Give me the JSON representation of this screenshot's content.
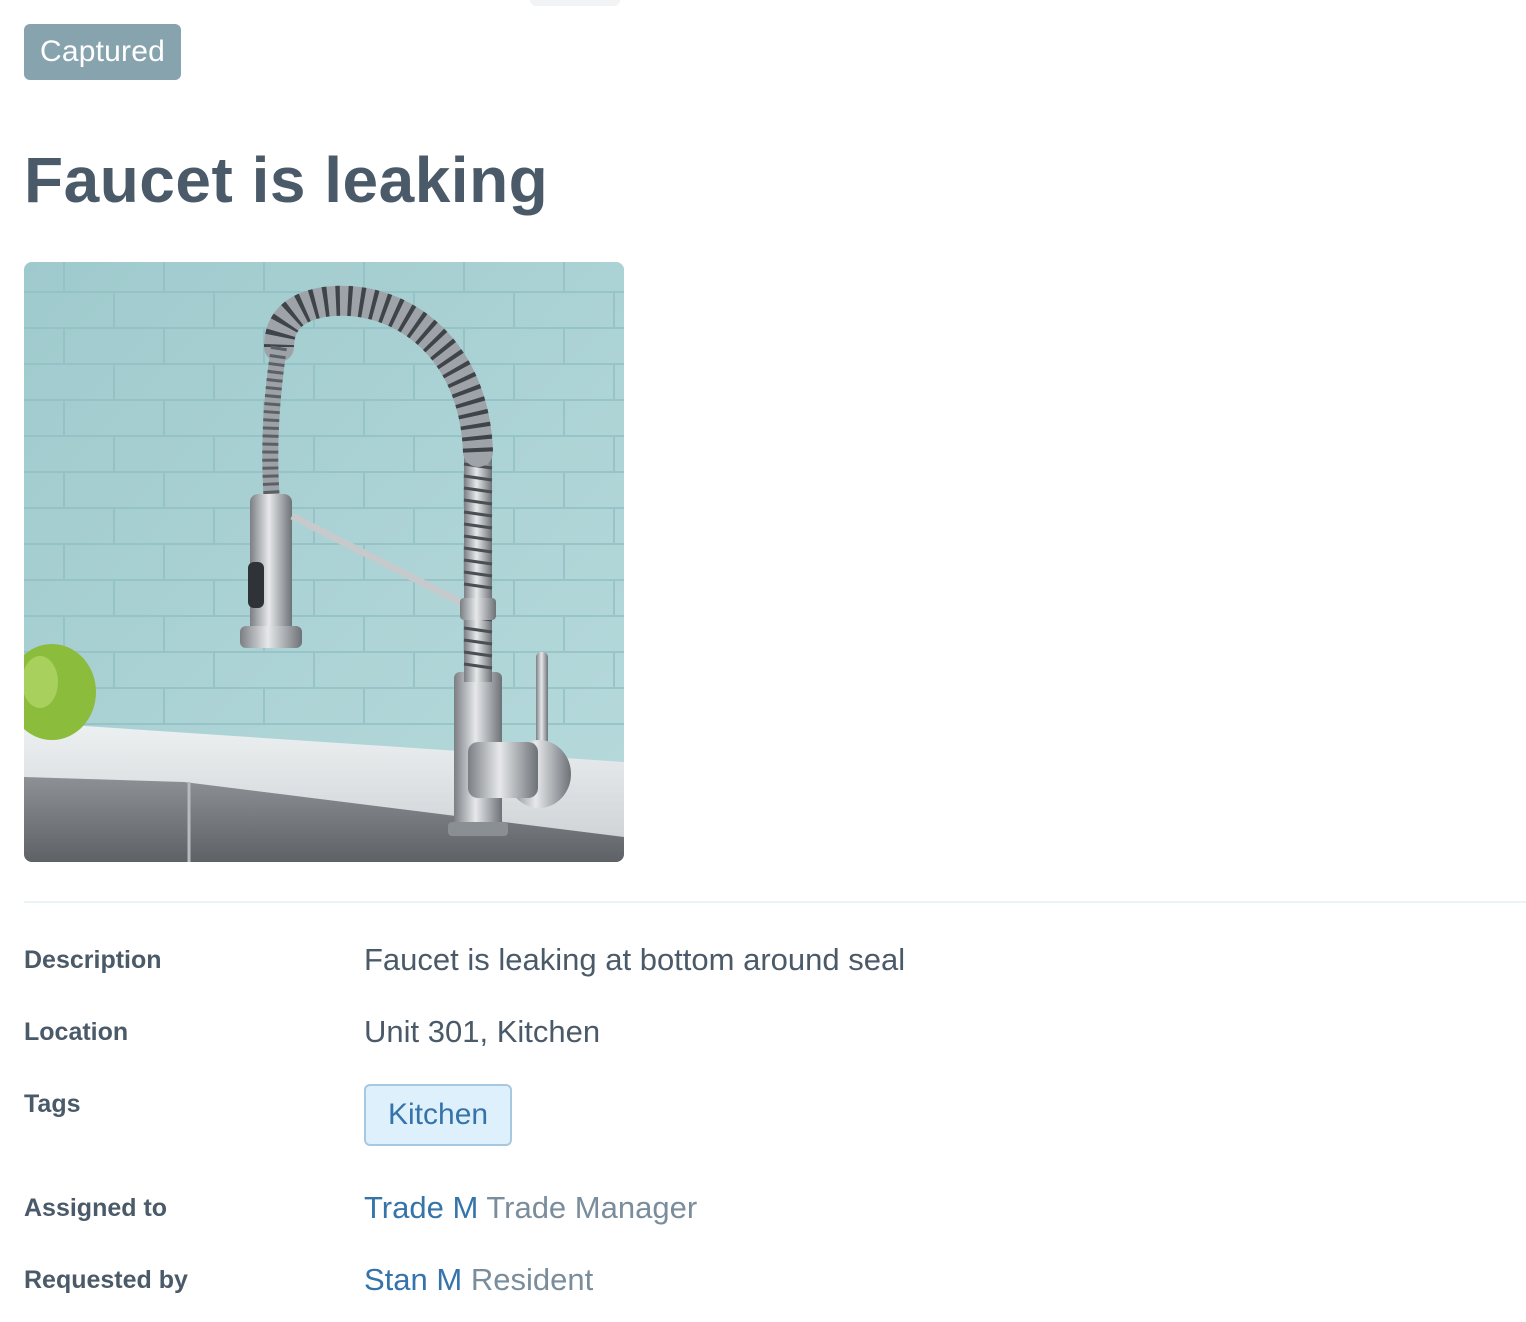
{
  "status": {
    "label": "Captured",
    "color": "#86a3ae"
  },
  "title": "Faucet is leaking",
  "photo": {
    "icon": "faucet-photo"
  },
  "details": {
    "description": {
      "label": "Description",
      "value": "Faucet is leaking at bottom around seal"
    },
    "location": {
      "label": "Location",
      "value": "Unit 301, Kitchen"
    },
    "tags": {
      "label": "Tags",
      "items": [
        "Kitchen"
      ]
    },
    "assigned_to": {
      "label": "Assigned to",
      "name": "Trade M",
      "role": "Trade Manager"
    },
    "requested_by": {
      "label": "Requested by",
      "name": "Stan M",
      "role": "Resident"
    }
  },
  "colors": {
    "text": "#4b5a69",
    "link": "#3574aa",
    "tag_bg": "#def0fb",
    "tag_border": "#a7c8de",
    "muted": "#7a8d9c"
  }
}
